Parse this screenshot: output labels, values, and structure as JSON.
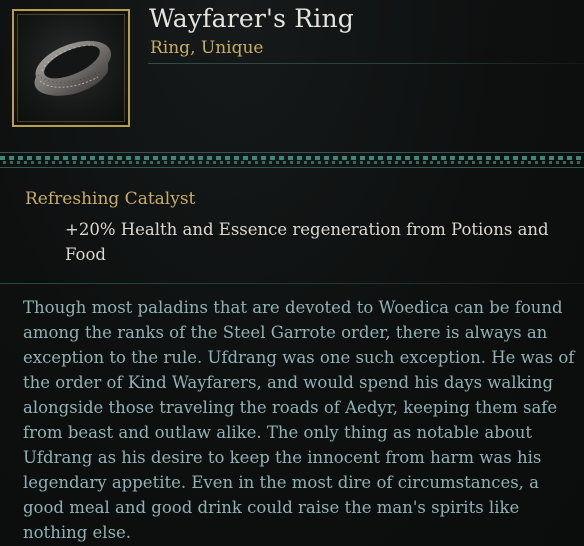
{
  "item": {
    "name": "Wayfarer's Ring",
    "type": "Ring, Unique",
    "icon": "silver-band-ring-icon"
  },
  "effect": {
    "title": "Refreshing Catalyst",
    "description": "+20% Health and Essence regeneration from Potions and Food"
  },
  "lore": "Though most paladins that are devoted to Woedica can be found among the ranks of the Steel Garrote order, there is always an exception to the rule. Ufdrang was one such exception. He was of the order of Kind Wayfarers, and would spend his days walking alongside those traveling the roads of Aedyr, keeping them safe from beast and outlaw alike. The only thing as notable about Ufdrang as his desire to keep the innocent from harm was his legendary appetite. Even in the most dire of circumstances, a good meal and good drink could raise the man's spirits like nothing else.",
  "colors": {
    "frame_gold": "#b8a04a",
    "title_text": "#e6e3dc",
    "subtitle_gold": "#c9ae62",
    "effect_text": "#dcd8cf",
    "lore_text": "#8fb2b5",
    "divider_teal": "#3f8578",
    "background": "#0d0f0f"
  }
}
